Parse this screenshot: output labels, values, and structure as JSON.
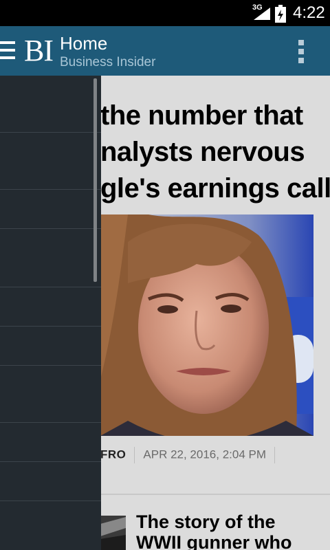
{
  "status_bar": {
    "network": "3G",
    "time": "4:22"
  },
  "action_bar": {
    "logo": "BI",
    "title": "Home",
    "subtitle": "Business Insider"
  },
  "article": {
    "headline_lines": [
      "the number that",
      "nalysts nervous",
      "gle's earnings call"
    ],
    "author": "FRO",
    "date": "APR 22, 2016, 2:04 PM"
  },
  "next_story": {
    "title": "The story of the WWII gunner who fell"
  },
  "drawer": {
    "item_count": 12
  }
}
